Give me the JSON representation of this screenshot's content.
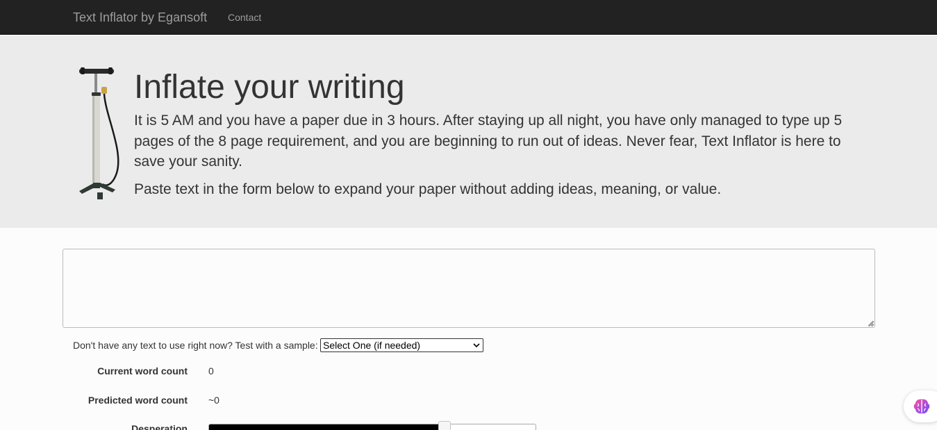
{
  "navbar": {
    "brand": "Text Inflator by Egansoft",
    "links": [
      {
        "label": "Contact"
      }
    ]
  },
  "hero": {
    "image_icon": "bicycle-pump-icon",
    "title": "Inflate your writing",
    "paragraph1": "It is 5 AM and you have a paper due in 3 hours. After staying up all night, you have only managed to type up 5 pages of the 8 page requirement, and you are beginning to run out of ideas. Never fear, Text Inflator is here to save your sanity.",
    "paragraph2": "Paste text in the form below to expand your paper without adding ideas, meaning, or value."
  },
  "form": {
    "textarea_value": "",
    "sample_label": "Don't have any text to use right now? Test with a sample:",
    "sample_selected": "Select One (if needed)"
  },
  "stats": {
    "current_label": "Current word count",
    "current_value": "0",
    "predicted_label": "Predicted word count",
    "predicted_value": "~0",
    "desperation_label": "Desperation",
    "desperation_level": 0.72
  },
  "colors": {
    "navbar_bg": "#222222",
    "navbar_text": "#9d9d9d",
    "hero_bg": "#ebebeb",
    "slider_fill": "#000000"
  },
  "extension_icon": "brain-icon"
}
